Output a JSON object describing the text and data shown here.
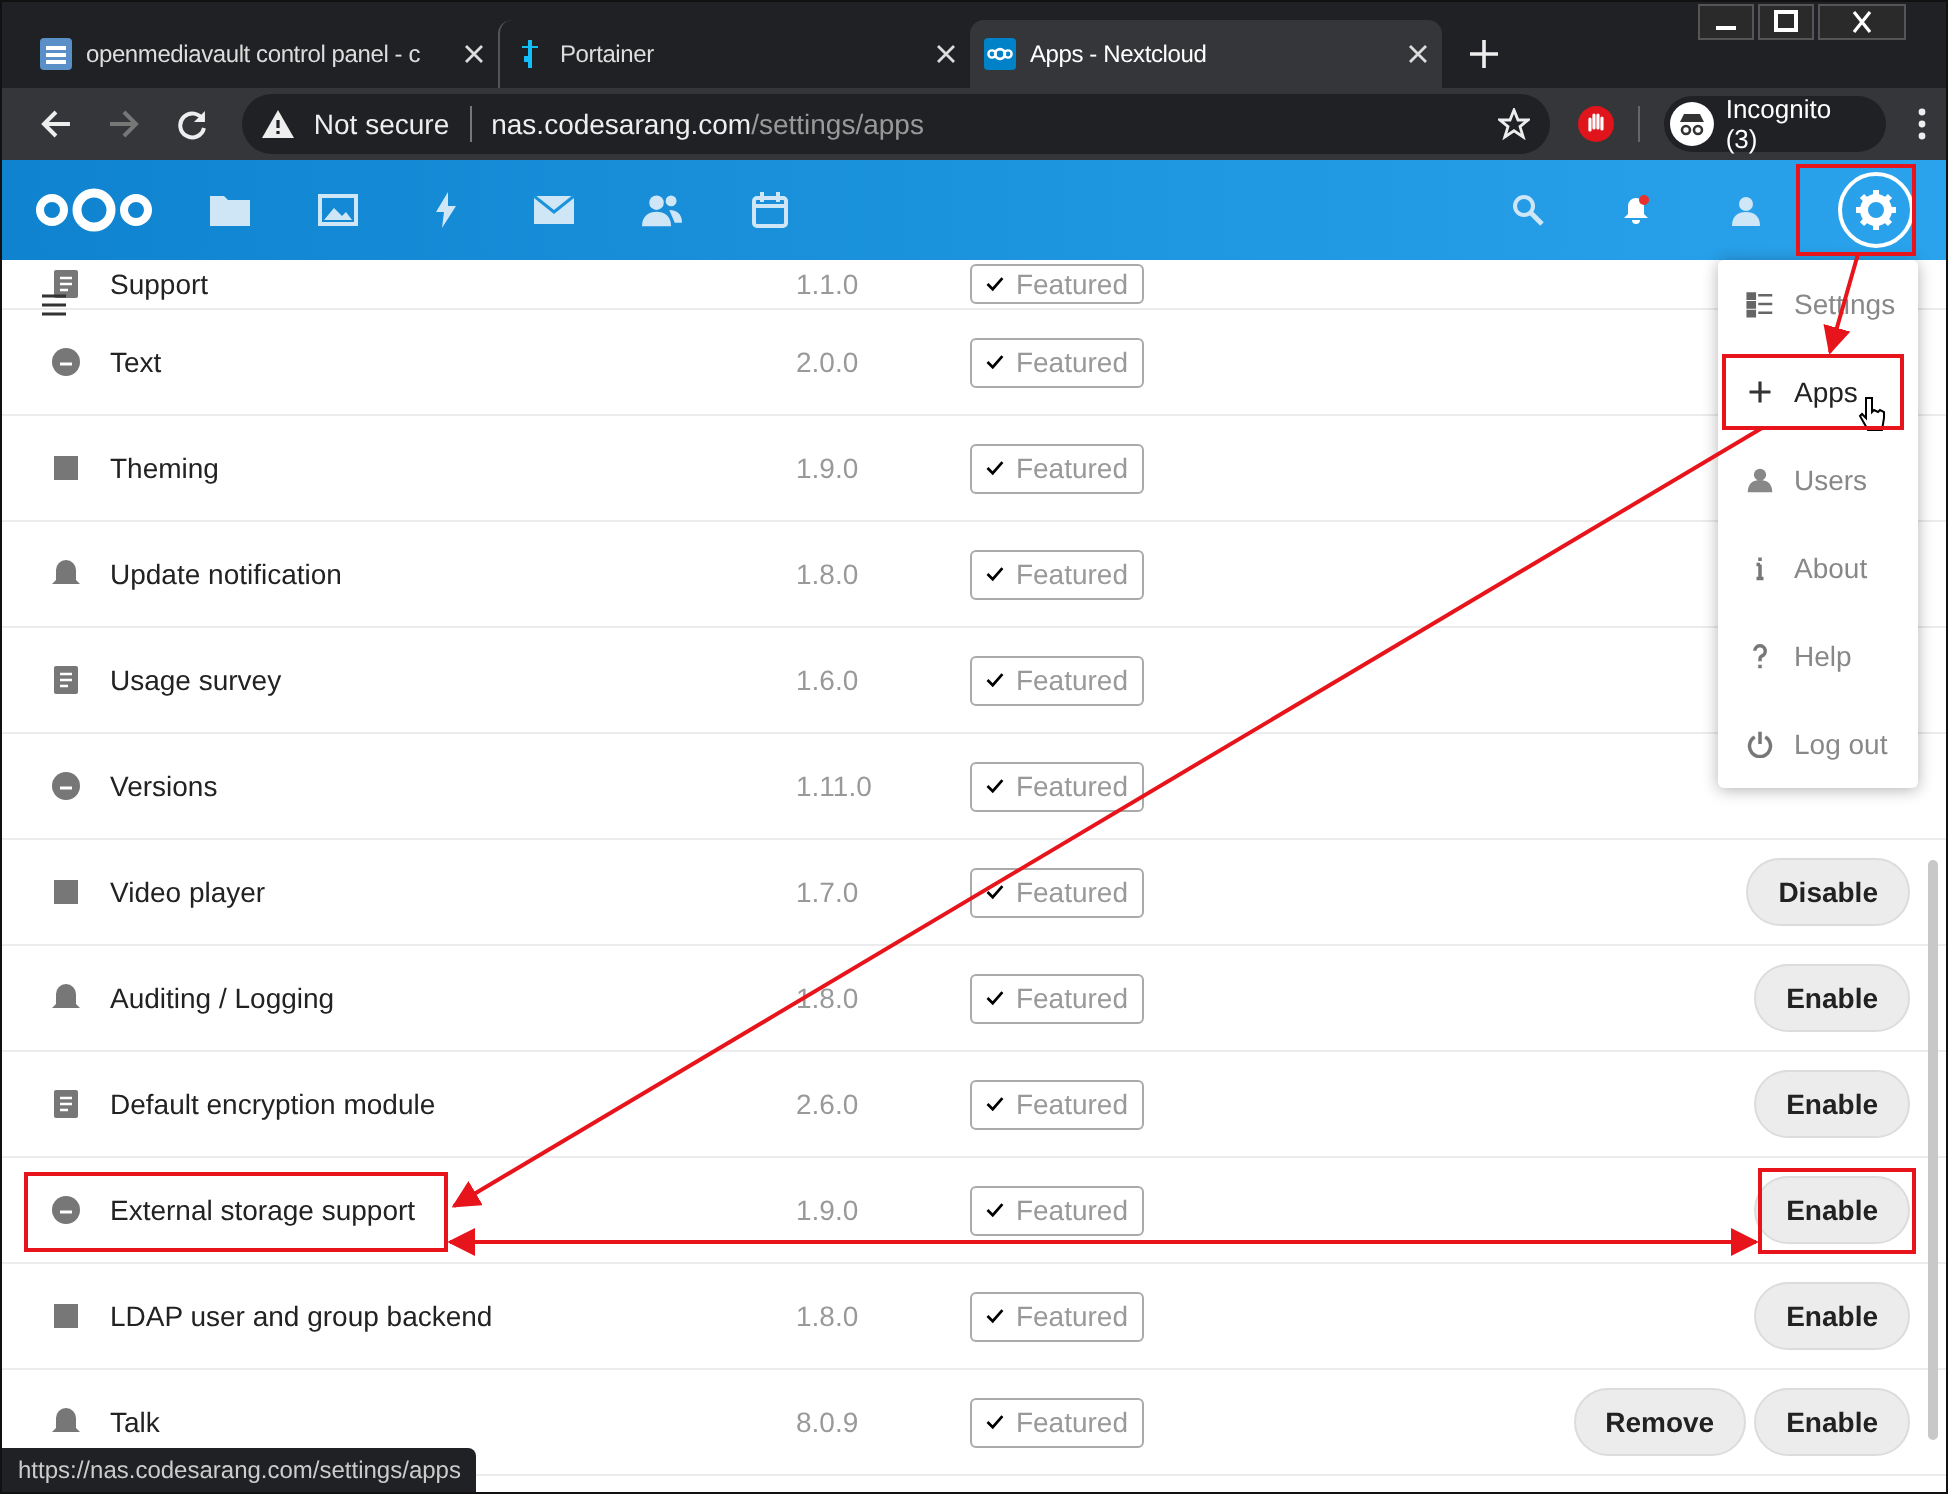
{
  "browser": {
    "tabs": [
      {
        "title": "openmediavault control panel - c",
        "selected": false
      },
      {
        "title": "Portainer",
        "selected": false
      },
      {
        "title": "Apps - Nextcloud",
        "selected": true
      }
    ],
    "security": "Not secure",
    "url_host": "nas.codesarang.com",
    "url_path": "/settings/apps",
    "profile": "Incognito (3)"
  },
  "apps": [
    {
      "name": "Support",
      "version": "1.1.0",
      "featured": "Featured"
    },
    {
      "name": "Text",
      "version": "2.0.0",
      "featured": "Featured"
    },
    {
      "name": "Theming",
      "version": "1.9.0",
      "featured": "Featured"
    },
    {
      "name": "Update notification",
      "version": "1.8.0",
      "featured": "Featured"
    },
    {
      "name": "Usage survey",
      "version": "1.6.0",
      "featured": "Featured"
    },
    {
      "name": "Versions",
      "version": "1.11.0",
      "featured": "Featured"
    },
    {
      "name": "Video player",
      "version": "1.7.0",
      "featured": "Featured",
      "buttons": [
        "Disable"
      ]
    },
    {
      "name": "Auditing / Logging",
      "version": "1.8.0",
      "featured": "Featured",
      "buttons": [
        "Enable"
      ]
    },
    {
      "name": "Default encryption module",
      "version": "2.6.0",
      "featured": "Featured",
      "buttons": [
        "Enable"
      ]
    },
    {
      "name": "External storage support",
      "version": "1.9.0",
      "featured": "Featured",
      "buttons": [
        "Enable"
      ]
    },
    {
      "name": "LDAP user and group backend",
      "version": "1.8.0",
      "featured": "Featured",
      "buttons": [
        "Enable"
      ]
    },
    {
      "name": "Talk",
      "version": "8.0.9",
      "featured": "Featured",
      "buttons": [
        "Remove",
        "Enable"
      ]
    }
  ],
  "settings_menu": [
    {
      "label": "Settings",
      "selected": false
    },
    {
      "label": "Apps",
      "selected": true
    },
    {
      "label": "Users",
      "selected": false
    },
    {
      "label": "About",
      "selected": false
    },
    {
      "label": "Help",
      "selected": false
    },
    {
      "label": "Log out",
      "selected": false
    }
  ],
  "status_bar": "https://nas.codesarang.com/settings/apps"
}
